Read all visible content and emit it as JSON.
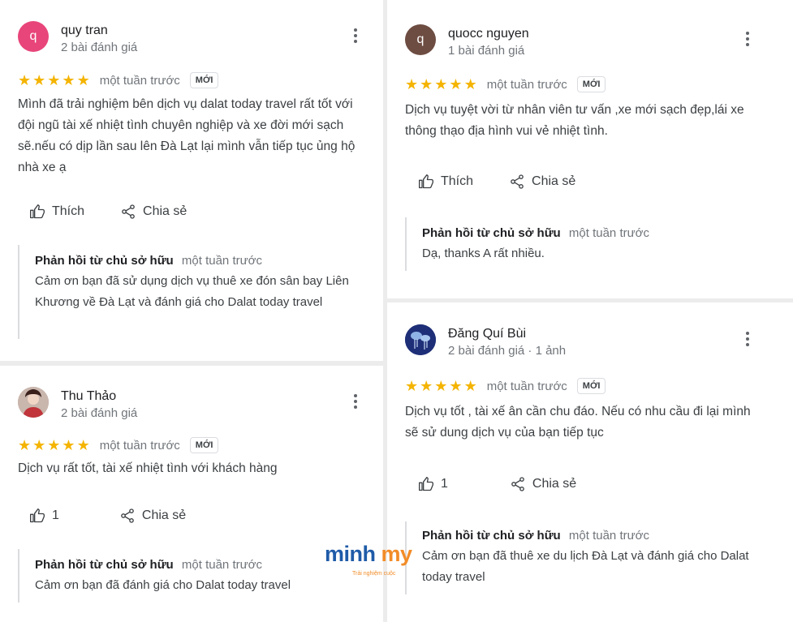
{
  "labels": {
    "like": "Thích",
    "share": "Chia sẻ",
    "owner_reply": "Phản hồi từ chủ sở hữu",
    "new_badge": "MỚI"
  },
  "colors": {
    "star": "#f4b400",
    "avatar_q": "#e8457a",
    "avatar_quocc": "#6d4c41",
    "reply_rule": "#dadce0"
  },
  "reviews": [
    {
      "avatar_letter": "q",
      "name": "quy tran",
      "meta": "2 bài đánh giá",
      "stars": 5,
      "time": "một tuần trước",
      "badge": "MỚI",
      "text": "Mình đã trải nghiệm bên dịch vụ dalat today travel rất tốt với đội ngũ tài xế nhiệt tình chuyên nghiệp và xe đời mới sạch sẽ.nếu có dịp lần sau lên Đà Lạt lại mình vẫn tiếp tục ủng hộ nhà xe ạ",
      "like_label": "Thích",
      "reply_time": "một tuần trước",
      "reply_text": "Cảm ơn bạn đã sử dụng dịch vụ thuê xe đón sân bay Liên Khương về Đà Lạt và đánh giá cho Dalat today travel"
    },
    {
      "avatar_letter": "",
      "name": "Thu Thảo",
      "meta": "2 bài đánh giá",
      "stars": 5,
      "time": "một tuần trước",
      "badge": "MỚI",
      "text": "Dịch vụ rất tốt, tài xế nhiệt tình với khách hàng",
      "like_label": "1",
      "reply_time": "một tuần trước",
      "reply_text": "Cảm ơn bạn đã đánh giá cho Dalat today travel"
    },
    {
      "avatar_letter": "q",
      "name": "quocc nguyen",
      "meta": "1 bài đánh giá",
      "stars": 5,
      "time": "một tuần trước",
      "badge": "MỚI",
      "text": "Dịch vụ tuyệt vời từ nhân viên tư vấn ,xe mới sạch đẹp,lái xe thông thạo địa hình vui vẻ nhiệt tình.",
      "like_label": "Thích",
      "reply_time": "một tuần trước",
      "reply_text": "Dạ, thanks A rất nhiều."
    },
    {
      "avatar_letter": "",
      "name": "Đăng Quí Bùi",
      "meta": "2 bài đánh giá · 1 ảnh",
      "stars": 5,
      "time": "một tuần trước",
      "badge": "MỚI",
      "text": "Dịch vụ tốt , tài xế ân cần chu đáo. Nếu có nhu cầu đi lại mình sẽ sử dung dịch vụ của bạn tiếp tục",
      "like_label": "1",
      "reply_time": "một tuần trước",
      "reply_text": "Cảm ơn bạn đã thuê xe du lịch Đà Lạt và đánh giá cho Dalat today travel"
    }
  ],
  "watermark": {
    "brand_a": "minh",
    "brand_b": "my",
    "tagline": "Trải nghiệm cuộc"
  }
}
